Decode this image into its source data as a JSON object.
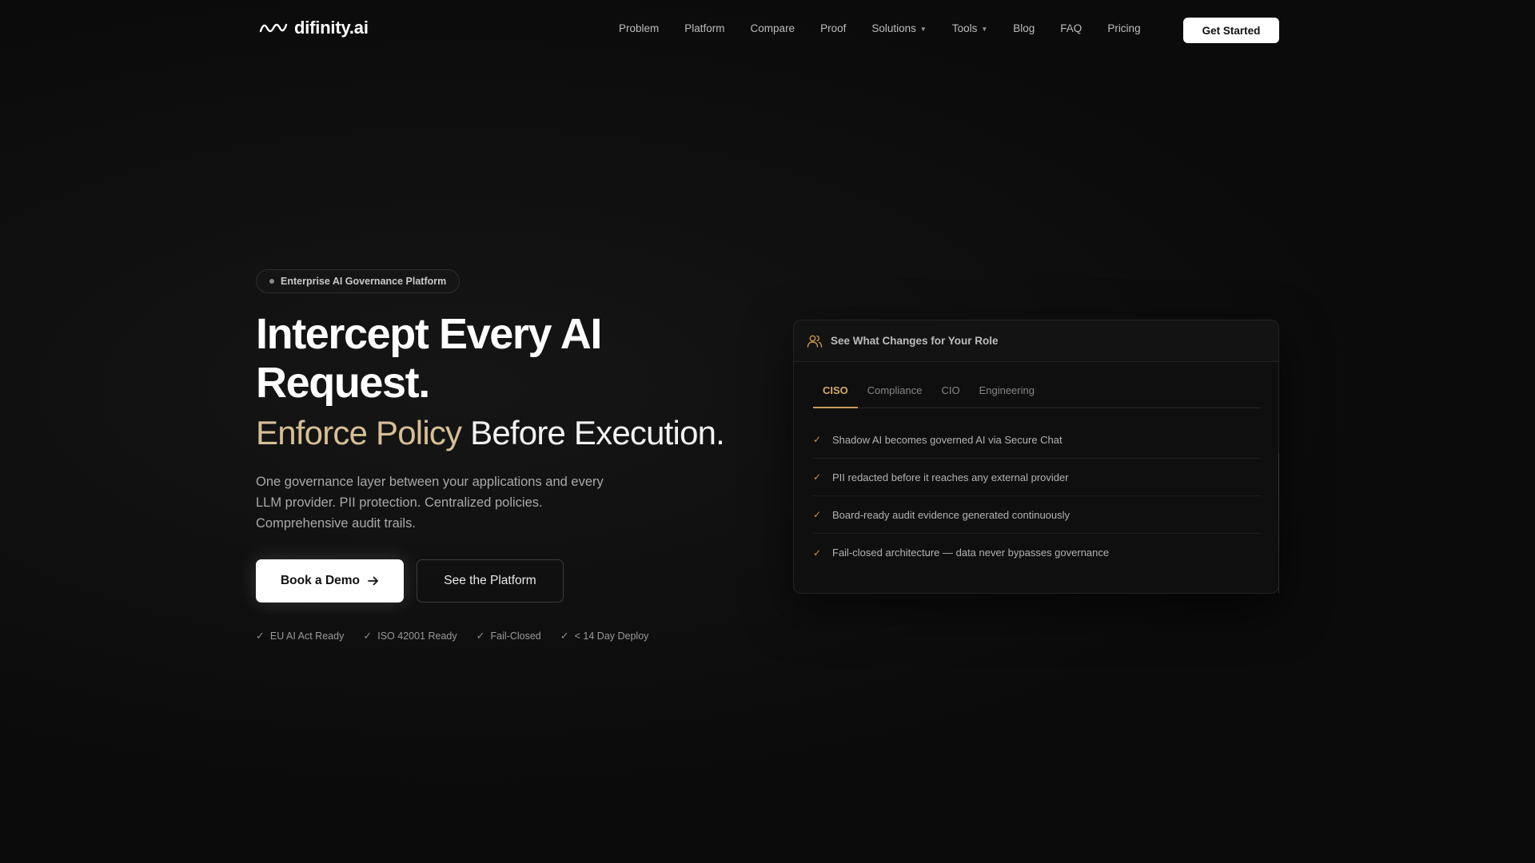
{
  "brand": {
    "name": "difinity.ai",
    "logo_icon": "wave-icon"
  },
  "nav": {
    "links": [
      {
        "label": "Problem",
        "dropdown": false
      },
      {
        "label": "Platform",
        "dropdown": false
      },
      {
        "label": "Compare",
        "dropdown": false
      },
      {
        "label": "Proof",
        "dropdown": false
      },
      {
        "label": "Solutions",
        "dropdown": true
      },
      {
        "label": "Tools",
        "dropdown": true
      },
      {
        "label": "Blog",
        "dropdown": false
      },
      {
        "label": "FAQ",
        "dropdown": false
      },
      {
        "label": "Pricing",
        "dropdown": false
      }
    ],
    "cta_label": "Get Started"
  },
  "hero": {
    "badge": "Enterprise AI Governance Platform",
    "title_line1": "Intercept Every AI",
    "title_line2": "Request.",
    "subtitle_gold": "Enforce Policy",
    "subtitle_white": " Before Execution.",
    "lede_line1": "One governance layer between your applications and every",
    "lede_line2": "LLM provider. PII protection. Centralized policies.",
    "lede_line3": "Comprehensive audit trails.",
    "primary_label": "Book a Demo",
    "primary_icon": "arrow-right-icon",
    "secondary_label": "See the Platform",
    "trust": [
      "EU AI Act Ready",
      "ISO 42001 Ready",
      "Fail-Closed",
      "< 14 Day Deploy"
    ]
  },
  "role_card": {
    "title": "See What Changes for Your Role",
    "icon": "users-icon",
    "tabs": [
      {
        "label": "CISO",
        "active": true
      },
      {
        "label": "Compliance",
        "active": false
      },
      {
        "label": "CIO",
        "active": false
      },
      {
        "label": "Engineering",
        "active": false
      }
    ],
    "items": [
      "Shadow AI becomes governed AI via Secure Chat",
      "PII redacted before it reaches any external provider",
      "Board-ready audit evidence generated continuously",
      "Fail-closed architecture — data never bypasses governance"
    ]
  },
  "colors": {
    "background": "#0b0b0b",
    "accent_gold": "#d6bf95",
    "accent_tab": "#c99a5a",
    "button_bg": "#ffffff"
  }
}
